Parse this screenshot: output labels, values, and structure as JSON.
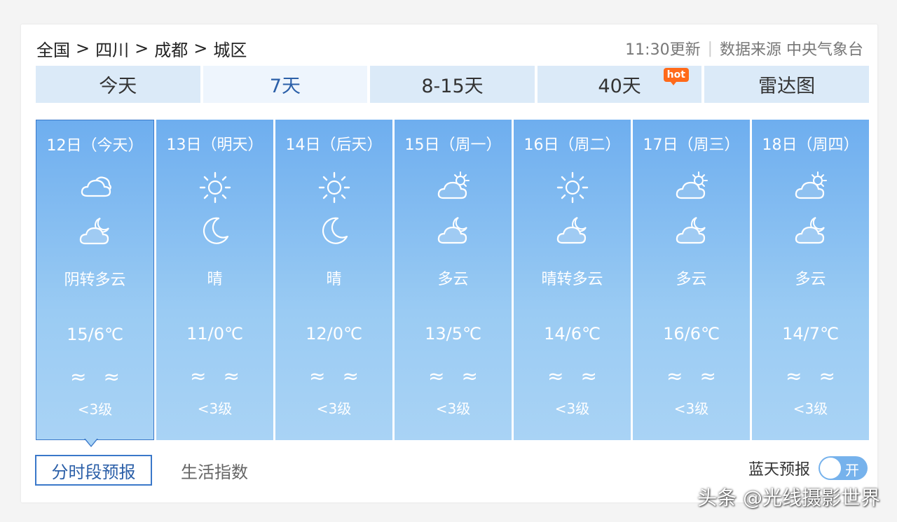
{
  "breadcrumb": [
    "全国",
    "四川",
    "成都",
    "城区"
  ],
  "breadcrumb_sep": ">",
  "meta": {
    "update": "11:30更新",
    "divider": "|",
    "source": "数据来源 中央气象台"
  },
  "tabs": [
    {
      "label": "今天"
    },
    {
      "label": "7天"
    },
    {
      "label": "8-15天"
    },
    {
      "label": "40天",
      "badge": "hot"
    },
    {
      "label": "雷达图"
    }
  ],
  "days": [
    {
      "date": "12日（今天）",
      "day_icon": "cloudy-icon",
      "night_icon": "partly-cloudy-night-icon",
      "desc": "阴转多云",
      "temp": "15/6℃",
      "wind": "≈",
      "level": "<3级"
    },
    {
      "date": "13日（明天）",
      "day_icon": "sun-icon",
      "night_icon": "moon-icon",
      "desc": "晴",
      "temp": "11/0℃",
      "wind": "≈",
      "level": "<3级"
    },
    {
      "date": "14日（后天）",
      "day_icon": "sun-icon",
      "night_icon": "moon-icon",
      "desc": "晴",
      "temp": "12/0℃",
      "wind": "≈",
      "level": "<3级"
    },
    {
      "date": "15日（周一）",
      "day_icon": "partly-cloudy-day-icon",
      "night_icon": "partly-cloudy-night-icon",
      "desc": "多云",
      "temp": "13/5℃",
      "wind": "≈",
      "level": "<3级"
    },
    {
      "date": "16日（周二）",
      "day_icon": "sun-icon",
      "night_icon": "partly-cloudy-night-icon",
      "desc": "晴转多云",
      "temp": "14/6℃",
      "wind": "≈",
      "level": "<3级"
    },
    {
      "date": "17日（周三）",
      "day_icon": "partly-cloudy-day-icon",
      "night_icon": "partly-cloudy-night-icon",
      "desc": "多云",
      "temp": "16/6℃",
      "wind": "≈",
      "level": "<3级"
    },
    {
      "date": "18日（周四）",
      "day_icon": "partly-cloudy-day-icon",
      "night_icon": "partly-cloudy-night-icon",
      "desc": "多云",
      "temp": "14/7℃",
      "wind": "≈",
      "level": "<3级"
    }
  ],
  "bottom_tabs": {
    "hourly": "分时段预报",
    "life": "生活指数"
  },
  "bluesky": {
    "label": "蓝天预报",
    "toggle": "开"
  },
  "watermark": "头条 @光线摄影世界",
  "colors": {
    "accent": "#3a78c9",
    "hot_badge": "#ff6a1a",
    "card_top": "#6eaeef",
    "card_bottom": "#a9d3f5"
  }
}
